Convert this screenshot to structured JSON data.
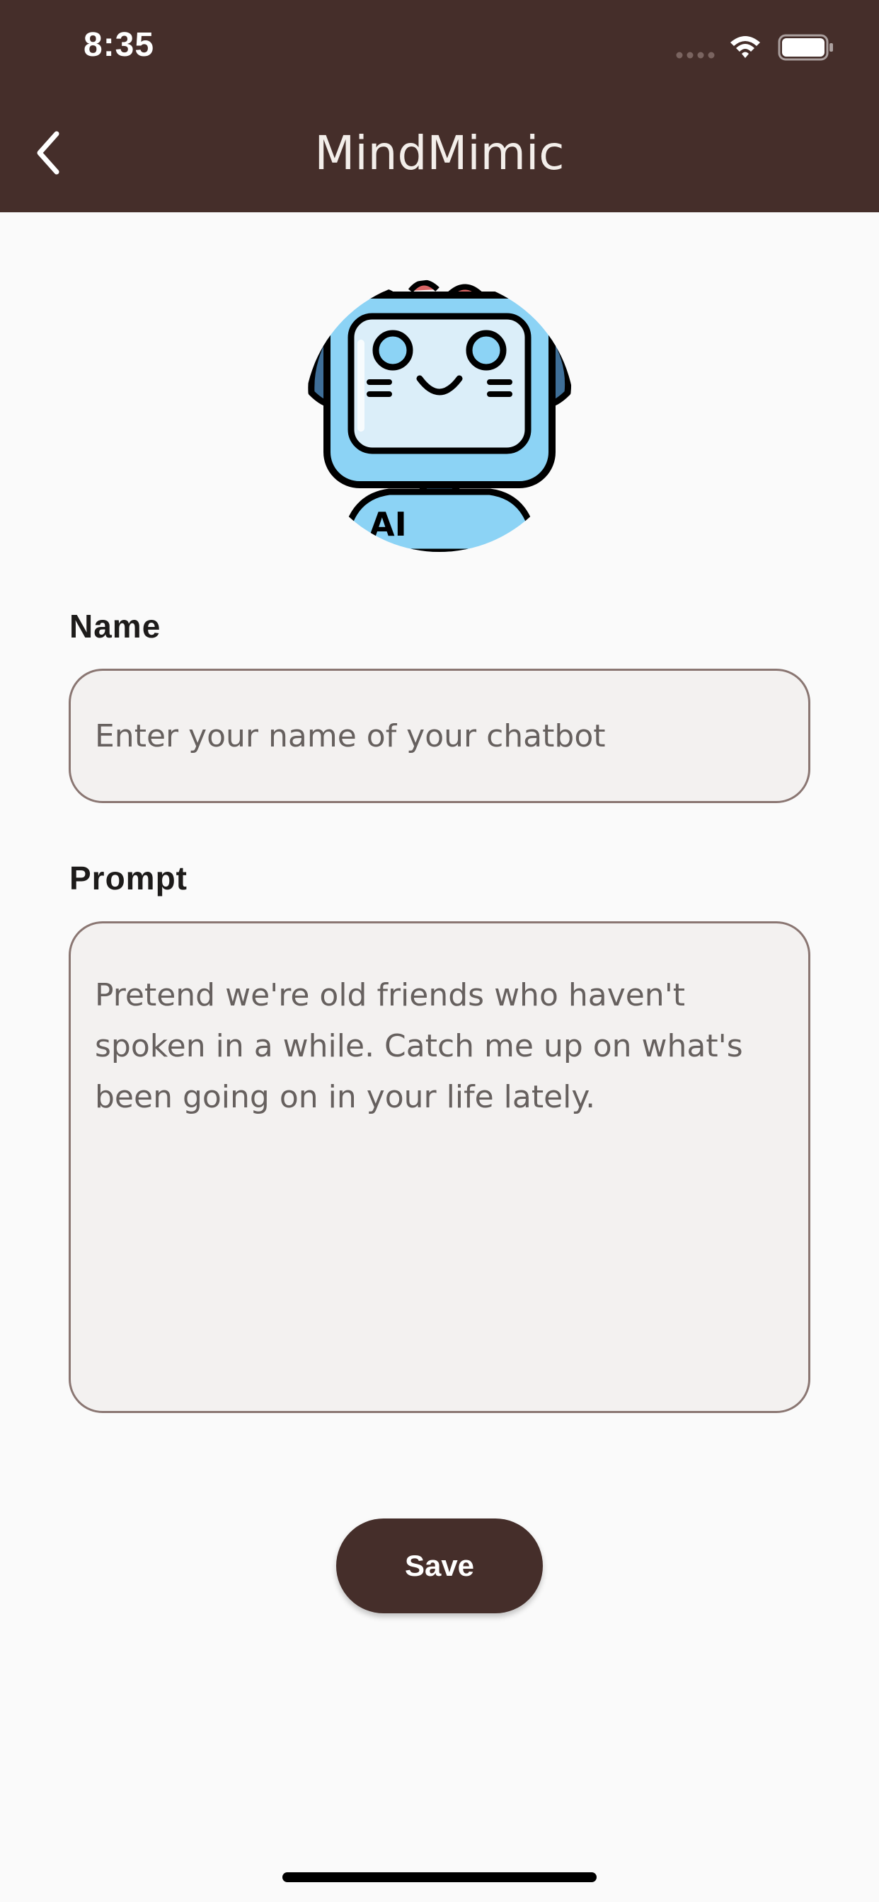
{
  "status_bar": {
    "time": "8:35"
  },
  "header": {
    "title": "MindMimic",
    "back_icon": "chevron-left-icon"
  },
  "avatar": {
    "icon": "robot-avatar-icon",
    "badge_text": "AI"
  },
  "form": {
    "name_label": "Name",
    "name_placeholder": "Enter your name of your chatbot",
    "name_value": "",
    "prompt_label": "Prompt",
    "prompt_placeholder": "Pretend we're old friends who haven't spoken in a while. Catch me up on what's been going on in your life lately.",
    "prompt_value": ""
  },
  "actions": {
    "save_label": "Save"
  },
  "colors": {
    "primary": "#452e2a",
    "background": "#fafafa",
    "input_fill": "#f3f1f0",
    "input_border": "#8a7672"
  }
}
